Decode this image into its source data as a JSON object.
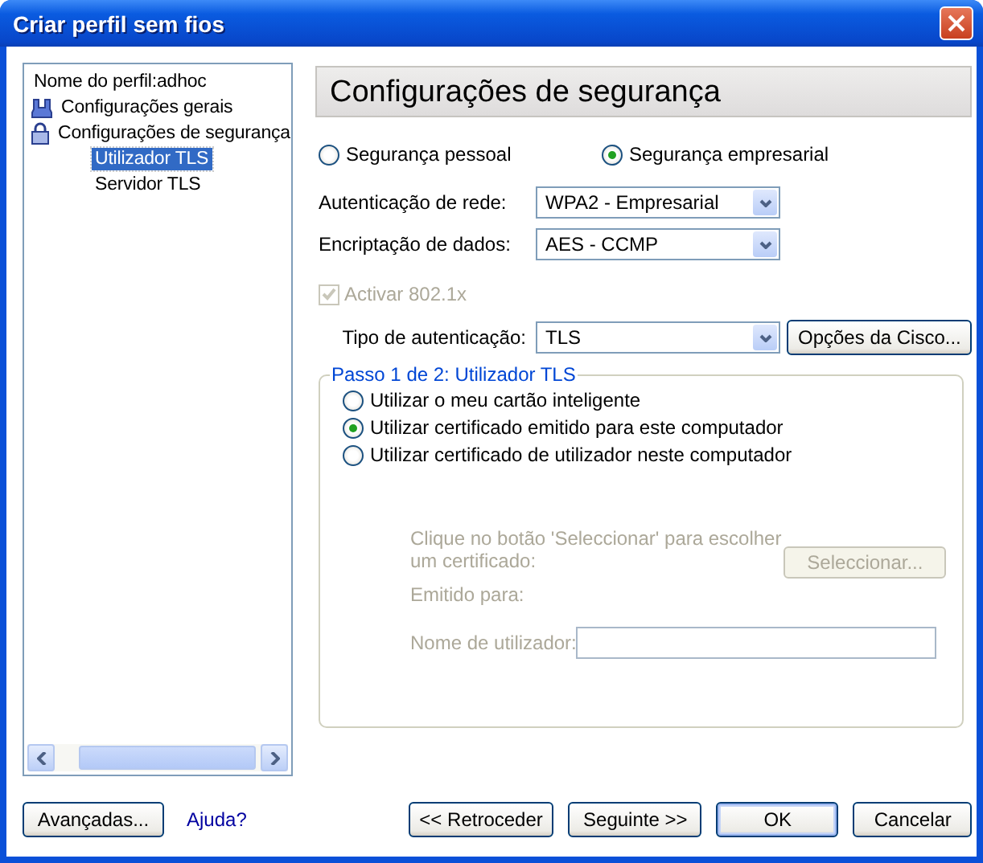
{
  "window": {
    "title": "Criar perfil sem fios"
  },
  "tree": {
    "items": [
      {
        "label": "Nome do perfil:adhoc",
        "selected": false
      },
      {
        "label": "Configurações gerais",
        "kind": "adapter",
        "selected": false
      },
      {
        "label": "Configurações de segurança",
        "kind": "lock",
        "selected": false,
        "children": [
          {
            "label": "Utilizador TLS",
            "selected": true
          },
          {
            "label": "Servidor TLS",
            "selected": false
          }
        ]
      }
    ]
  },
  "panel": {
    "heading": "Configurações de segurança",
    "security_modes": [
      {
        "label": "Segurança pessoal",
        "selected": false
      },
      {
        "label": "Segurança empresarial",
        "selected": true
      }
    ],
    "fields": [
      {
        "label": "Autenticação de rede:",
        "value": "WPA2 - Empresarial"
      },
      {
        "label": "Encriptação de dados:",
        "value": "AES - CCMP"
      }
    ],
    "enable_8021x": {
      "label": "Activar 802.1x",
      "checked": true,
      "disabled": true
    },
    "auth_type": {
      "label": "Tipo de autenticação:",
      "value": "TLS",
      "button": "Opções da Cisco..."
    },
    "step_group": {
      "legend": "Passo 1 de 2: Utilizador TLS",
      "options": [
        {
          "label": "Utilizar o meu cartão inteligente",
          "selected": false
        },
        {
          "label": "Utilizar certificado emitido para este computador",
          "selected": true
        },
        {
          "label": "Utilizar certificado de utilizador neste computador",
          "selected": false
        }
      ],
      "instruction": "Clique no botão 'Seleccionar' para escolher um certificado:",
      "select_button": {
        "label": "Seleccionar...",
        "disabled": true
      },
      "issued_to": "Emitido para:",
      "username": {
        "label": "Nome de utilizador:",
        "disabled": true
      }
    }
  },
  "footer": {
    "left": [
      {
        "label": "Avançadas...",
        "kind": "button"
      },
      {
        "label": "Ajuda?",
        "kind": "link"
      }
    ],
    "right": [
      {
        "label": "<< Retroceder",
        "default": false
      },
      {
        "label": "Seguinte >>",
        "default": false
      },
      {
        "label": "OK",
        "default": true
      },
      {
        "label": "Cancelar",
        "default": false
      }
    ]
  }
}
